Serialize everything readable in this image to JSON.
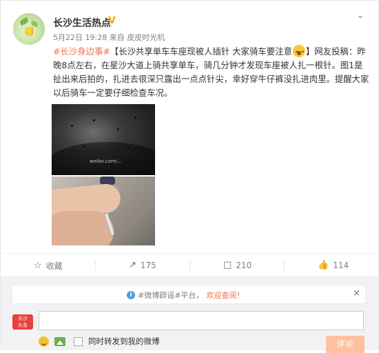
{
  "post": {
    "username": "长沙生活热点",
    "verified_badge": "V",
    "time": "5月22日 19:28",
    "source_prefix": "来自",
    "source": "皮皮时光机",
    "hashtag": "#长沙身边事#",
    "title": "【长沙共享单车车座现被人插针 大家骑车要注意",
    "title_end": "】网友投稿：",
    "body": "昨晚8点左右，在星沙大道上骑共享单车，骑几分钟才发现车座被人扎一根针。图1是扯出来后拍的，扎进去很深只露出一点点针尖，幸好穿牛仔裤没扎进肉里。提醒大家以后骑车一定要仔细检查车况。",
    "photo1_watermark": "weibo.com/..."
  },
  "actions": {
    "favorite_label": "收藏",
    "repost_count": "175",
    "comment_count": "210",
    "like_count": "114"
  },
  "notice": {
    "text": "#微博辟谣#平台，",
    "highlight": "欢迎查阅！"
  },
  "composer": {
    "logo_line1": "长沙",
    "logo_line2": "头条",
    "forward_label": "同时转发到我的微博",
    "submit_label": "评论"
  },
  "icons": [
    "avatar",
    "verified-badge-icon",
    "chevron-down-icon",
    "star-icon",
    "repost-icon",
    "comment-icon",
    "like-icon",
    "info-icon",
    "close-icon",
    "emoji-icon",
    "image-icon"
  ]
}
